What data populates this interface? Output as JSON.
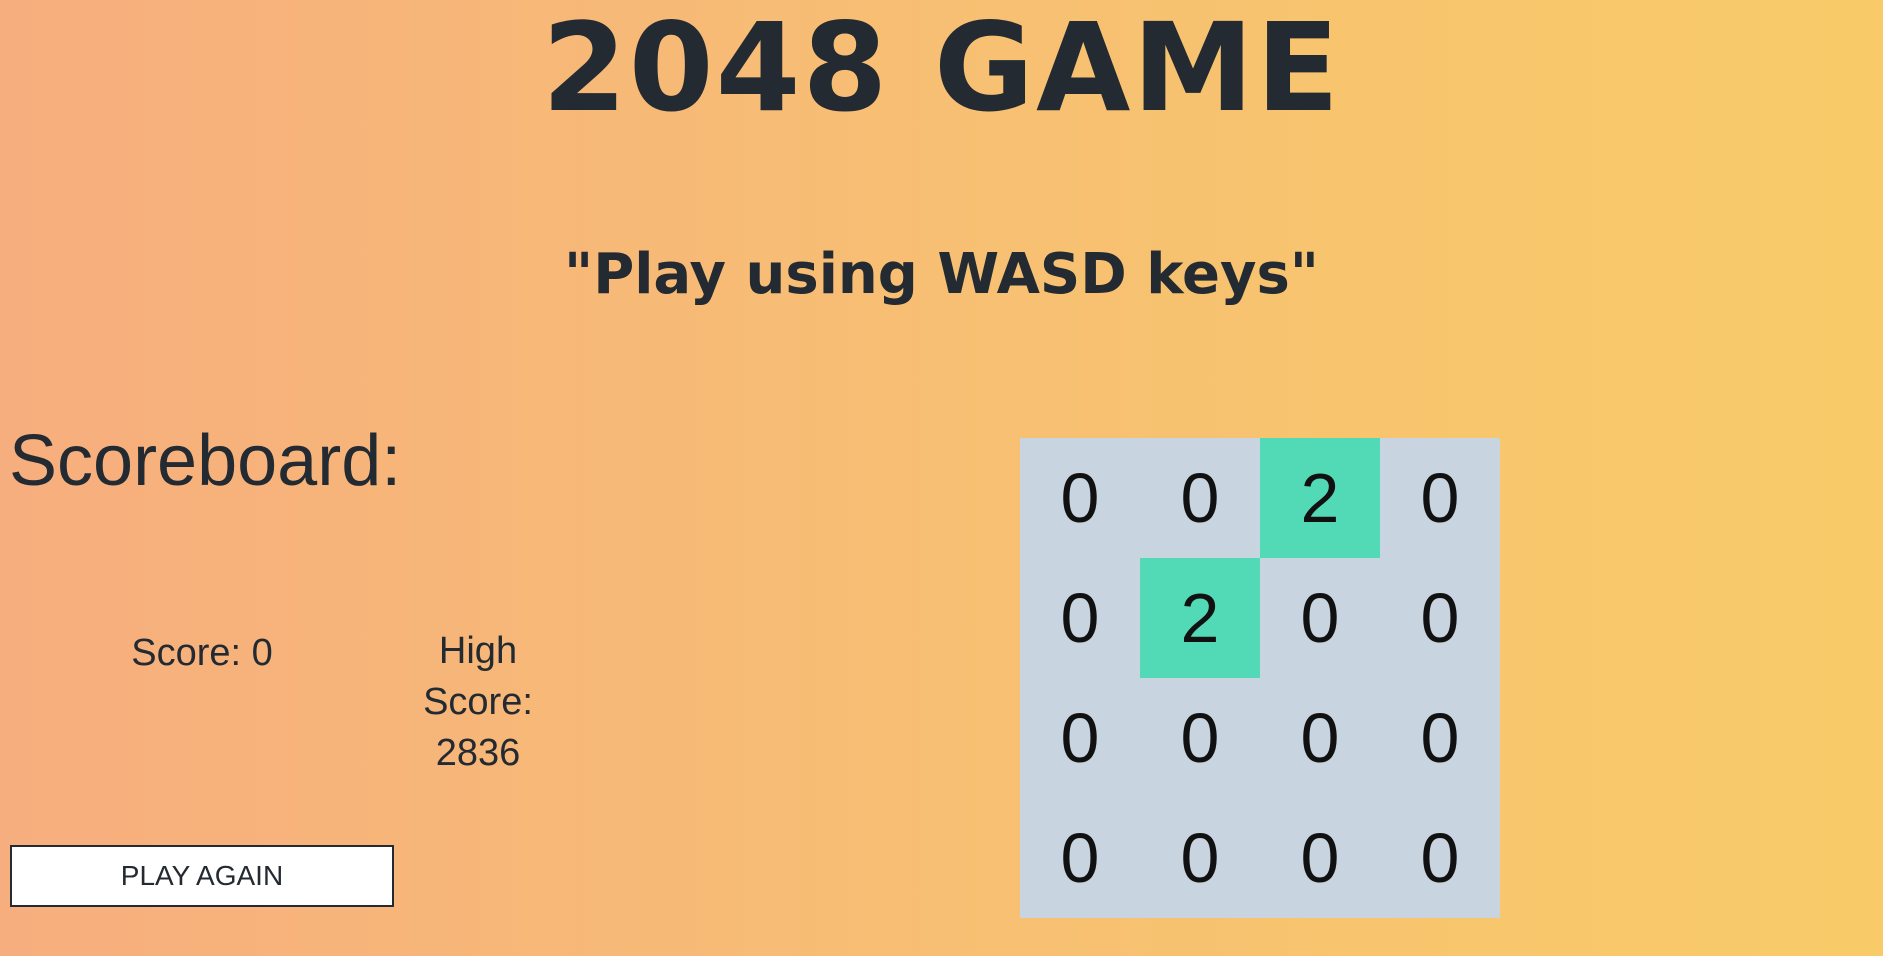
{
  "header": {
    "title": "2048 GAME",
    "subtitle": "\"Play using WASD keys\""
  },
  "scoreboard": {
    "title": "Scoreboard:",
    "score_label": "Score: 0",
    "high_score_label": "High Score: 2836"
  },
  "controls": {
    "play_again_label": "PLAY AGAIN"
  },
  "board": {
    "tiles": [
      [
        "0",
        "0",
        "2",
        "0"
      ],
      [
        "0",
        "2",
        "0",
        "0"
      ],
      [
        "0",
        "0",
        "0",
        "0"
      ],
      [
        "0",
        "0",
        "0",
        "0"
      ]
    ]
  },
  "colors": {
    "background_left": "#f7ae7e",
    "background_right": "#f8cb68",
    "board_background": "#c8d4df",
    "filled_tile": "#52dab6",
    "text": "#232a31"
  }
}
